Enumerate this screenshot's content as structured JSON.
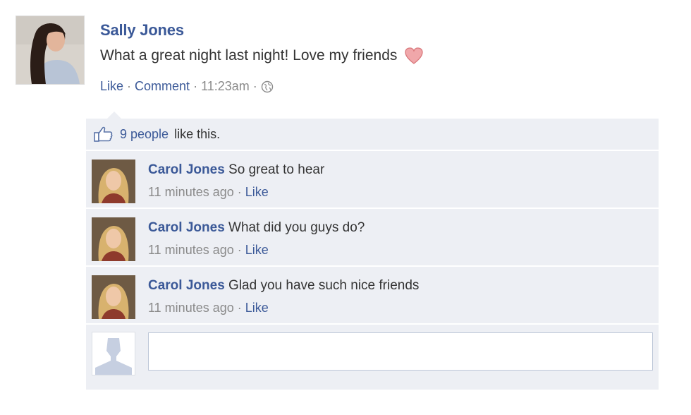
{
  "post": {
    "author": "Sally Jones",
    "text": "What a great night last night! Love my friends",
    "actions": {
      "like": "Like",
      "separator": "·",
      "comment": "Comment",
      "time": "11:23am"
    },
    "icons": [
      "heart-icon",
      "globe-icon"
    ]
  },
  "likes": {
    "count_link": "9 people",
    "suffix": "like this.",
    "icon": "thumbs-up-icon"
  },
  "comments": [
    {
      "author": "Carol Jones",
      "text": "So great to hear",
      "time": "11 minutes ago",
      "like": "Like"
    },
    {
      "author": "Carol Jones",
      "text": "What did you guys do?",
      "time": "11 minutes ago",
      "like": "Like"
    },
    {
      "author": "Carol Jones",
      "text": "Glad you have such nice friends",
      "time": "11 minutes ago",
      "like": "Like"
    }
  ],
  "reply": {
    "placeholder": "",
    "avatar_icon": "default-user-silhouette-icon"
  },
  "colors": {
    "link": "#3b5998",
    "feedback_bg": "#edeff4",
    "meta": "#8a8a8a",
    "heart": "#e8898d"
  }
}
